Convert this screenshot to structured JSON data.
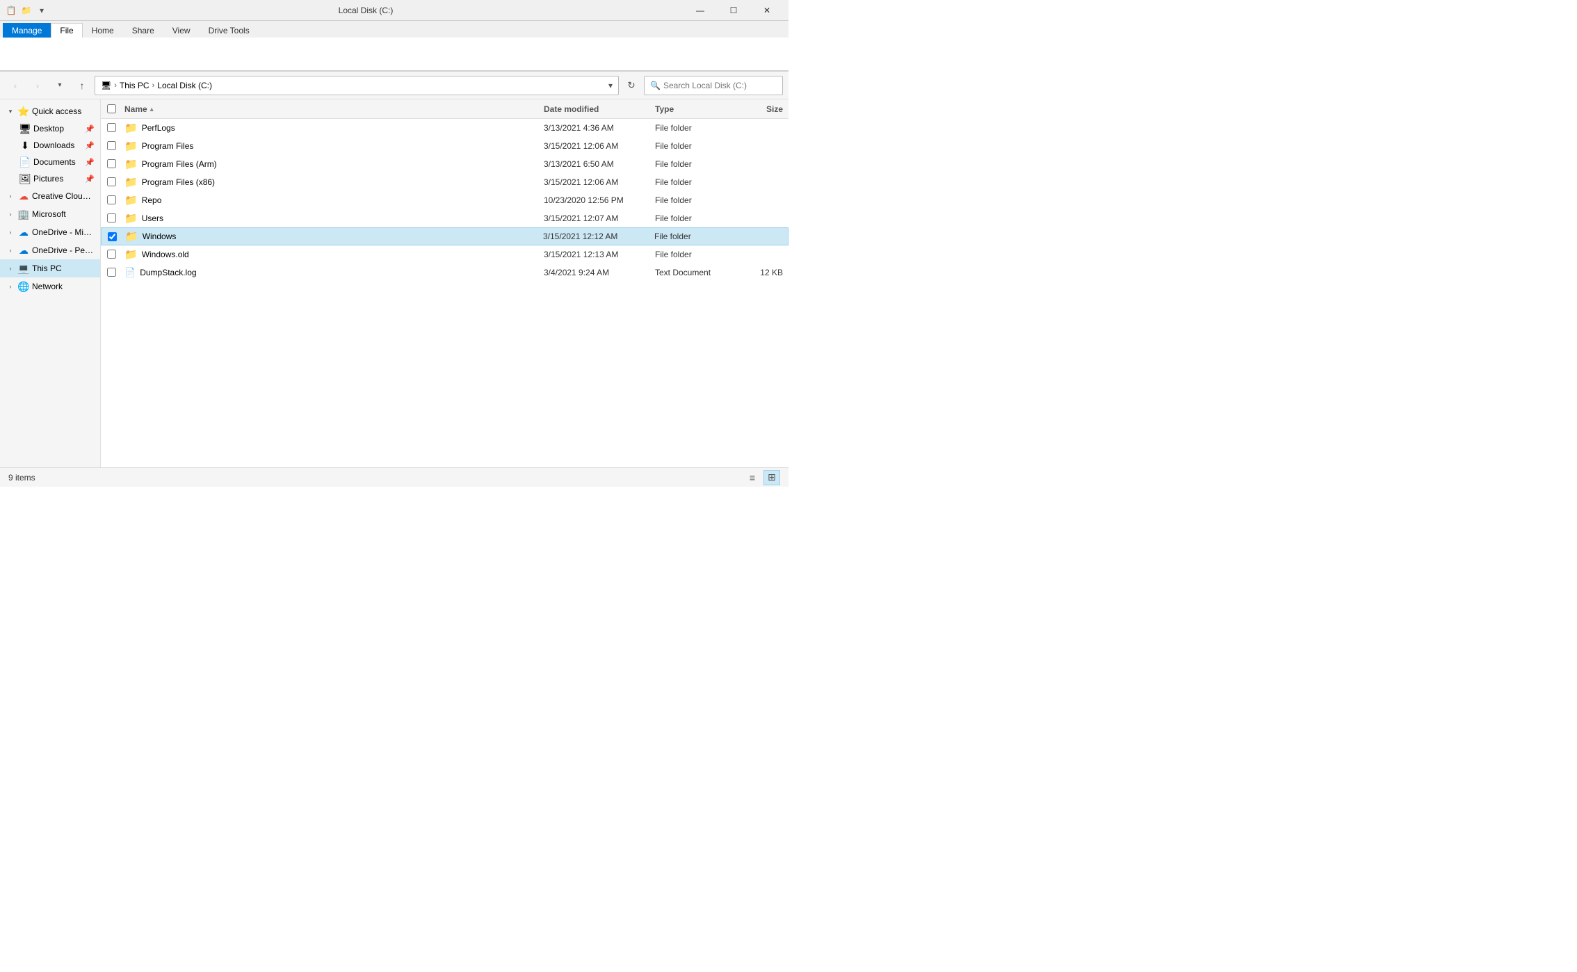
{
  "titleBar": {
    "title": "Local Disk (C:)",
    "icons": [
      "📋",
      "📁",
      "⬇"
    ],
    "controls": {
      "minimize": "—",
      "maximize": "☐",
      "close": "✕"
    }
  },
  "ribbon": {
    "manageTab": "Manage",
    "tabs": [
      "File",
      "Home",
      "Share",
      "View",
      "Drive Tools"
    ],
    "activeTab": "File",
    "driveToolsLabel": "Drive Tools"
  },
  "addressBar": {
    "back": "‹",
    "forward": "›",
    "dropdown": "▾",
    "up": "↑",
    "breadcrumb": [
      "This PC",
      "Local Disk (C:)"
    ],
    "refreshIcon": "↻",
    "search": {
      "placeholder": "Search Local Disk (C:)",
      "icon": "🔍"
    }
  },
  "sidebar": {
    "quickAccess": {
      "label": "Quick access",
      "icon": "⭐",
      "expanded": true,
      "items": [
        {
          "label": "Desktop",
          "icon": "🖥",
          "pinned": true
        },
        {
          "label": "Downloads",
          "icon": "⬇",
          "pinned": true
        },
        {
          "label": "Documents",
          "icon": "📄",
          "pinned": true
        },
        {
          "label": "Pictures",
          "icon": "🖼",
          "pinned": true
        }
      ]
    },
    "creativeCloud": {
      "label": "Creative Cloud Files",
      "icon": "☁",
      "expanded": false
    },
    "microsoft": {
      "label": "Microsoft",
      "icon": "🏢",
      "expanded": false
    },
    "oneDriveMicrosoft": {
      "label": "OneDrive - Microsoft",
      "icon": "☁",
      "expanded": false
    },
    "oneDrivePersonal": {
      "label": "OneDrive - Personal",
      "icon": "☁",
      "expanded": false
    },
    "thisPC": {
      "label": "This PC",
      "icon": "💻",
      "expanded": true,
      "selected": true
    },
    "network": {
      "label": "Network",
      "icon": "🌐",
      "expanded": false
    }
  },
  "fileList": {
    "columns": {
      "name": "Name",
      "dateModified": "Date modified",
      "type": "Type",
      "size": "Size"
    },
    "sortIndicator": "▲",
    "items": [
      {
        "id": 1,
        "name": "PerfLogs",
        "dateModified": "3/13/2021 4:36 AM",
        "type": "File folder",
        "size": "",
        "icon": "folder",
        "selected": false
      },
      {
        "id": 2,
        "name": "Program Files",
        "dateModified": "3/15/2021 12:06 AM",
        "type": "File folder",
        "size": "",
        "icon": "folder",
        "selected": false
      },
      {
        "id": 3,
        "name": "Program Files (Arm)",
        "dateModified": "3/13/2021 6:50 AM",
        "type": "File folder",
        "size": "",
        "icon": "folder",
        "selected": false
      },
      {
        "id": 4,
        "name": "Program Files (x86)",
        "dateModified": "3/15/2021 12:06 AM",
        "type": "File folder",
        "size": "",
        "icon": "folder",
        "selected": false
      },
      {
        "id": 5,
        "name": "Repo",
        "dateModified": "10/23/2020 12:56 PM",
        "type": "File folder",
        "size": "",
        "icon": "folder",
        "selected": false
      },
      {
        "id": 6,
        "name": "Users",
        "dateModified": "3/15/2021 12:07 AM",
        "type": "File folder",
        "size": "",
        "icon": "folder",
        "selected": false
      },
      {
        "id": 7,
        "name": "Windows",
        "dateModified": "3/15/2021 12:12 AM",
        "type": "File folder",
        "size": "",
        "icon": "folder",
        "selected": true
      },
      {
        "id": 8,
        "name": "Windows.old",
        "dateModified": "3/15/2021 12:13 AM",
        "type": "File folder",
        "size": "",
        "icon": "folder",
        "selected": false
      },
      {
        "id": 9,
        "name": "DumpStack.log",
        "dateModified": "3/4/2021 9:24 AM",
        "type": "Text Document",
        "size": "12 KB",
        "icon": "file",
        "selected": false
      }
    ]
  },
  "statusBar": {
    "itemCount": "9 items",
    "viewDetails": "≡",
    "viewLarge": "⊞"
  }
}
